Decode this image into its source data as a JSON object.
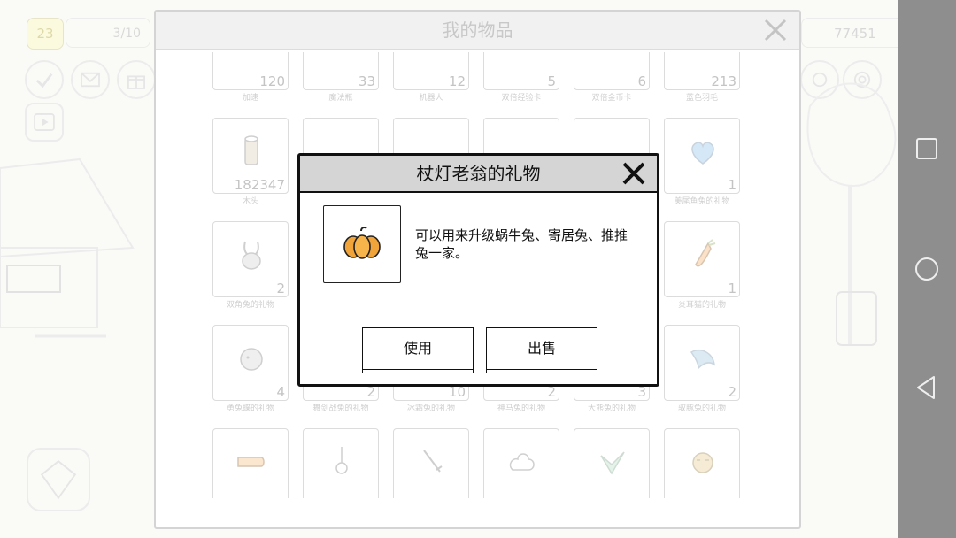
{
  "hud": {
    "level": "23",
    "progress": "3/10",
    "coins": "77451"
  },
  "inventory": {
    "title": "我的物品",
    "items": [
      {
        "name": "加速",
        "count": "120",
        "icon": "speed-icon"
      },
      {
        "name": "魔法瓶",
        "count": "33",
        "icon": "magic-bottle-icon"
      },
      {
        "name": "机器人",
        "count": "12",
        "icon": "robot-icon"
      },
      {
        "name": "双倍经验卡",
        "count": "5",
        "icon": "exp-card-icon"
      },
      {
        "name": "双倍金币卡",
        "count": "6",
        "icon": "coin-card-icon"
      },
      {
        "name": "蓝色羽毛",
        "count": "213",
        "icon": "blue-feather-icon"
      },
      {
        "name": "木头",
        "count": "182347",
        "icon": "wood-log-icon"
      },
      {
        "name": "",
        "count": "",
        "icon": "hidden"
      },
      {
        "name": "",
        "count": "",
        "icon": "hidden"
      },
      {
        "name": "",
        "count": "",
        "icon": "hidden"
      },
      {
        "name": "",
        "count": "",
        "icon": "hidden"
      },
      {
        "name": "美尾鱼兔的礼物",
        "count": "1",
        "icon": "blue-heart-icon"
      },
      {
        "name": "双角兔的礼物",
        "count": "2",
        "icon": "bunny-icon"
      },
      {
        "name": "",
        "count": "",
        "icon": "hidden"
      },
      {
        "name": "",
        "count": "",
        "icon": "hidden"
      },
      {
        "name": "",
        "count": "",
        "icon": "hidden"
      },
      {
        "name": "",
        "count": "",
        "icon": "hidden"
      },
      {
        "name": "炎耳猫的礼物",
        "count": "1",
        "icon": "carrot-icon"
      },
      {
        "name": "勇兔蝶的礼物",
        "count": "4",
        "icon": "fluffball-icon"
      },
      {
        "name": "舞剑战兔的礼物",
        "count": "2",
        "icon": "hidden"
      },
      {
        "name": "冰霜兔的礼物",
        "count": "10",
        "icon": "hidden"
      },
      {
        "name": "神马兔的礼物",
        "count": "2",
        "icon": "hidden"
      },
      {
        "name": "大熊兔的礼物",
        "count": "3",
        "icon": "hidden"
      },
      {
        "name": "驭豚兔的礼物",
        "count": "2",
        "icon": "dolphin-icon"
      },
      {
        "name": "",
        "count": "",
        "icon": "carrot-root-icon"
      },
      {
        "name": "",
        "count": "",
        "icon": "pendant-icon"
      },
      {
        "name": "",
        "count": "",
        "icon": "sword-icon"
      },
      {
        "name": "",
        "count": "",
        "icon": "cloud-icon"
      },
      {
        "name": "",
        "count": "",
        "icon": "check-icon"
      },
      {
        "name": "",
        "count": "",
        "icon": "tiger-icon"
      }
    ]
  },
  "popup": {
    "title": "杖灯老翁的礼物",
    "item_icon": "pumpkin-icon",
    "description": "可以用来升级蜗牛兔、寄居兔、推推兔一家。",
    "use_label": "使用",
    "sell_label": "出售"
  },
  "colors": {
    "popup_border": "#111111",
    "popup_header": "#d5d5d5",
    "pumpkin": "#f0a43a",
    "navbar": "#8e8e8e"
  }
}
